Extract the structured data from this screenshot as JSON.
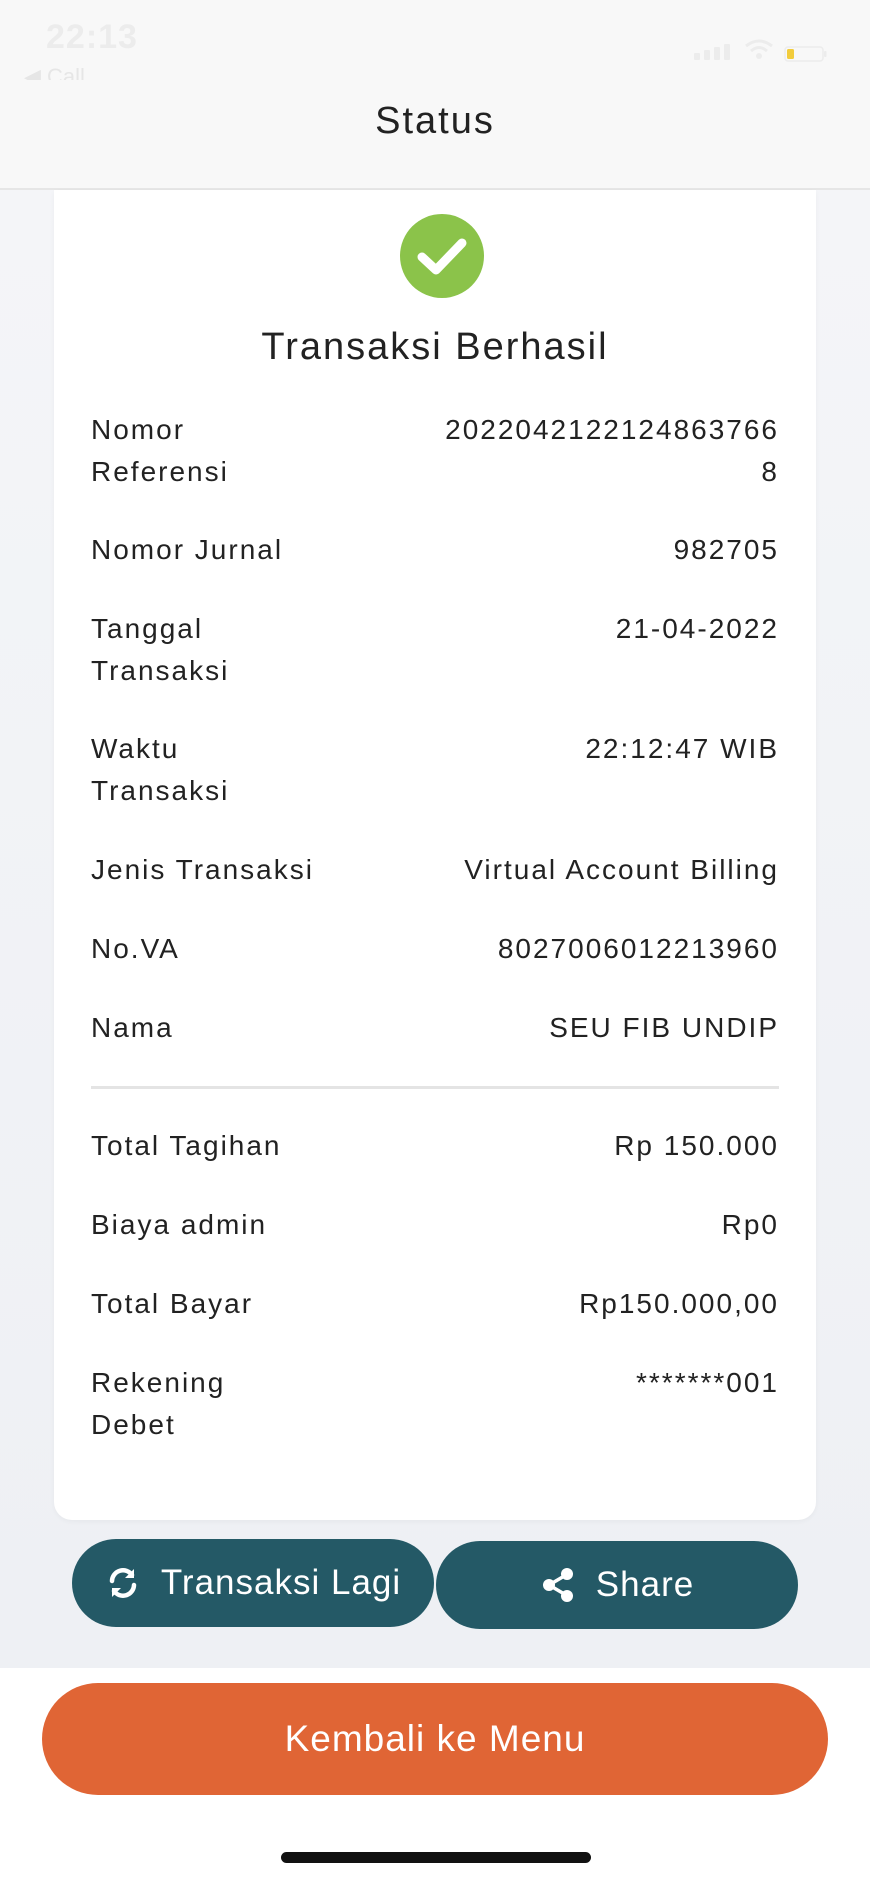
{
  "status_bar": {
    "time": "22:13",
    "back_label": "◀ Call"
  },
  "header": {
    "title": "Status"
  },
  "result": {
    "icon": "check-circle-icon",
    "title": "Transaksi Berhasil",
    "accent_color": "#8bc34a"
  },
  "details": [
    {
      "label_line1": "Nomor",
      "label_line2": "Referensi",
      "value_line1": "2022042122124863766",
      "value_line2": "8"
    },
    {
      "label_line1": "Nomor Jurnal",
      "label_line2": "",
      "value_line1": "982705",
      "value_line2": ""
    },
    {
      "label_line1": "Tanggal",
      "label_line2": "Transaksi",
      "value_line1": "21-04-2022",
      "value_line2": ""
    },
    {
      "label_line1": "Waktu",
      "label_line2": "Transaksi",
      "value_line1": "22:12:47 WIB",
      "value_line2": ""
    },
    {
      "label_line1": "Jenis Transaksi",
      "label_line2": "",
      "value_line1": "Virtual Account Billing",
      "value_line2": ""
    },
    {
      "label_line1": "No.VA",
      "label_line2": "",
      "value_line1": "8027006012213960",
      "value_line2": ""
    },
    {
      "label_line1": "Nama",
      "label_line2": "",
      "value_line1": "SEU FIB UNDIP",
      "value_line2": ""
    }
  ],
  "totals": [
    {
      "label_line1": "Total Tagihan",
      "label_line2": "",
      "value_line1": "Rp 150.000"
    },
    {
      "label_line1": "Biaya admin",
      "label_line2": "",
      "value_line1": "Rp0"
    },
    {
      "label_line1": "Total Bayar",
      "label_line2": "",
      "value_line1": "Rp150.000,00"
    },
    {
      "label_line1": "Rekening",
      "label_line2": "Debet",
      "value_line1": "*******001"
    }
  ],
  "actions": {
    "again_label": "Transaksi Lagi",
    "again_icon": "refresh-icon",
    "share_label": "Share",
    "share_icon": "share-icon",
    "menu_label": "Kembali ke Menu",
    "primary_color": "#245966",
    "menu_color": "#e06535"
  }
}
